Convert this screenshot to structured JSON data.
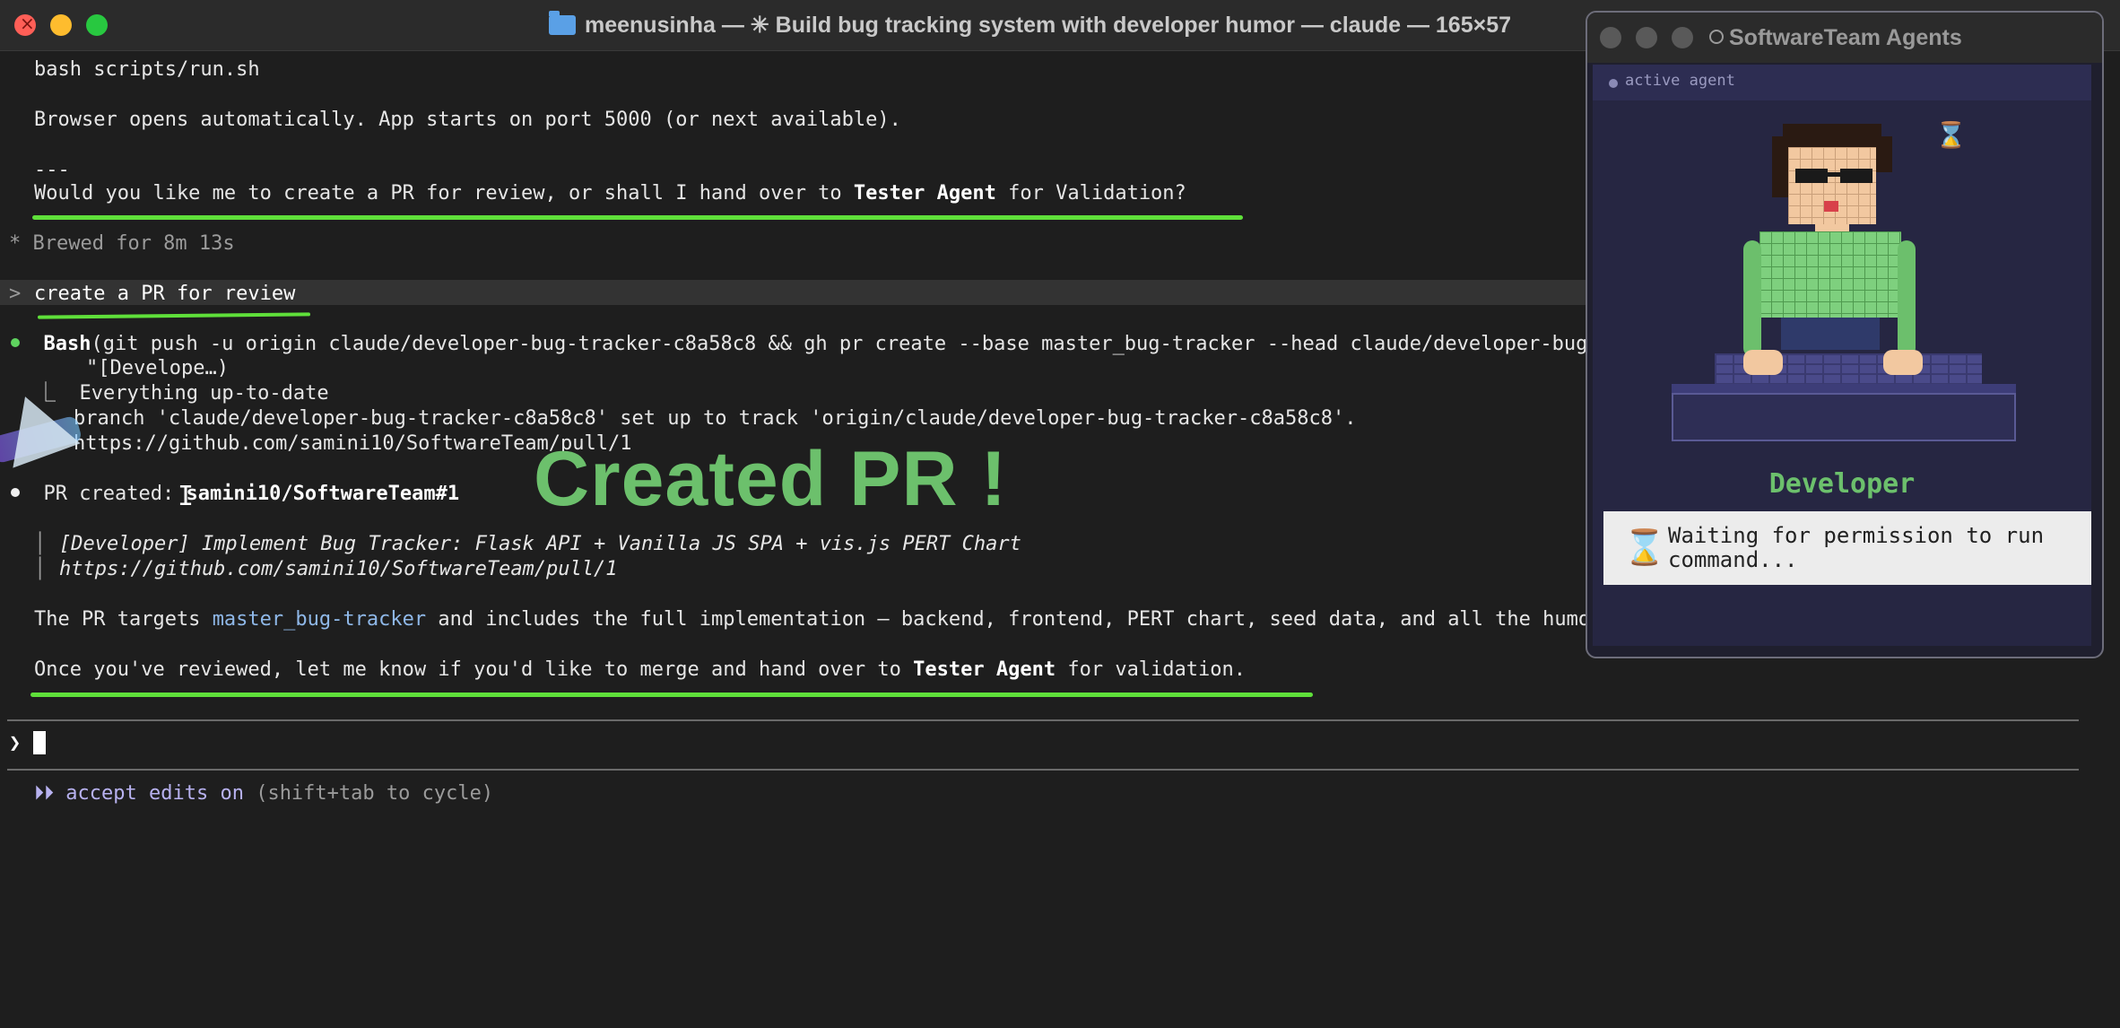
{
  "window": {
    "title": "meenusinha — ✳ Build bug tracking system with developer humor — claude — 165×57"
  },
  "terminal": {
    "l_run": "bash scripts/run.sh",
    "l_browser": "Browser opens automatically. App starts on port 5000 (or next available).",
    "l_sep": "---",
    "l_q_a": "Would you like me to create a PR for review, or shall I hand over to ",
    "l_q_b": "Tester Agent",
    "l_q_c": " for Validation?",
    "l_brewed": "* Brewed for 8m 13s",
    "l_prompt_prefix": ">",
    "l_user": "create a PR for review",
    "l_bash_a": "Bash",
    "l_bash_b": "(git push -u origin claude/developer-bug-tracker-c8a58c8 && gh pr create --base master_bug-tracker --head claude/developer-bug-tr",
    "l_bash_cont": "\"[Develope…)",
    "l_out_1": "⎿  Everything up-to-date",
    "l_out_2": "branch 'claude/developer-bug-tracker-c8a58c8' set up to track 'origin/claude/developer-bug-tracker-c8a58c8'.",
    "l_out_3": "https://github.com/samini10/SoftwareTeam/pull/1",
    "l_pr_a": "PR created: ",
    "l_pr_b": "samini10/SoftwareTeam#1",
    "l_quote_1": "[Developer] Implement Bug Tracker: Flask API + Vanilla JS SPA + vis.js PERT Chart",
    "l_quote_2": "https://github.com/samini10/SoftwareTeam/pull/1",
    "l_targets_a": "The PR targets ",
    "l_targets_b": "master_bug-tracker",
    "l_targets_c": " and includes the full implementation — backend, frontend, PERT chart, seed data, and all the humor.",
    "l_once_a": "Once you've reviewed, let me know if you'd like to merge and hand over to ",
    "l_once_b": "Tester Agent",
    "l_once_c": " for validation.",
    "input_prompt": "❯",
    "mode_arrows": "⏵⏵",
    "mode_label": "accept edits on",
    "mode_hint": " (shift+tab to cycle)"
  },
  "overlay": {
    "caption": "Created PR !"
  },
  "agent_panel": {
    "title": "SoftwareTeam Agents",
    "active_label": "active agent",
    "agent_name": "Developer",
    "status_text": "Waiting for permission to run command...",
    "colors": {
      "name": "#6cc06c",
      "shirt": "#7ed07e",
      "skin": "#f2c8a0",
      "hair": "#2a1a12",
      "keyboard": "#4a4a8a"
    }
  }
}
